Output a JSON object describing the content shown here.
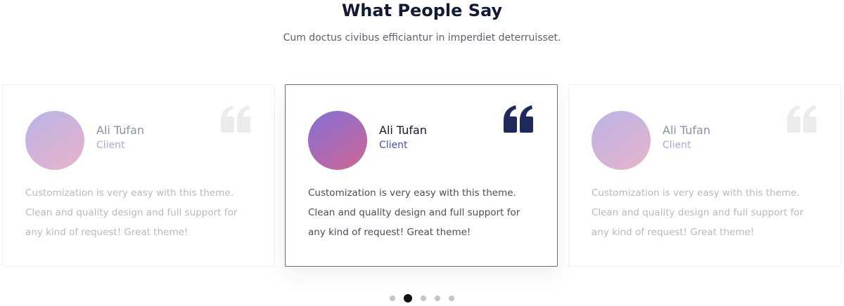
{
  "section": {
    "title": "What People Say",
    "subtitle": "Cum doctus civibus efficiantur in imperdiet deterruisset."
  },
  "testimonials": [
    {
      "name": "Ali Tufan",
      "role": "Client",
      "text": "Customization is very easy with this theme. Clean and quality design and full support for any kind of request! Great theme!",
      "active": false
    },
    {
      "name": "Ali Tufan",
      "role": "Client",
      "text": "Customization is very easy with this theme. Clean and quality design and full support for any kind of request! Great theme!",
      "active": true
    },
    {
      "name": "Ali Tufan",
      "role": "Client",
      "text": "Customization is very easy with this theme. Clean and quality design and full support for any kind of request! Great theme!",
      "active": false
    }
  ],
  "icons": {
    "quote": "quote-icon",
    "avatar": "avatar"
  },
  "colors": {
    "heading": "#141a33",
    "active_border": "#6e6c85",
    "active_quote": "#1e2a5c",
    "inactive_quote": "#ececec",
    "active_dot": "#111111",
    "inactive_dot": "#c4c4c4"
  },
  "pagination": {
    "count": 5,
    "active_index": 1
  }
}
